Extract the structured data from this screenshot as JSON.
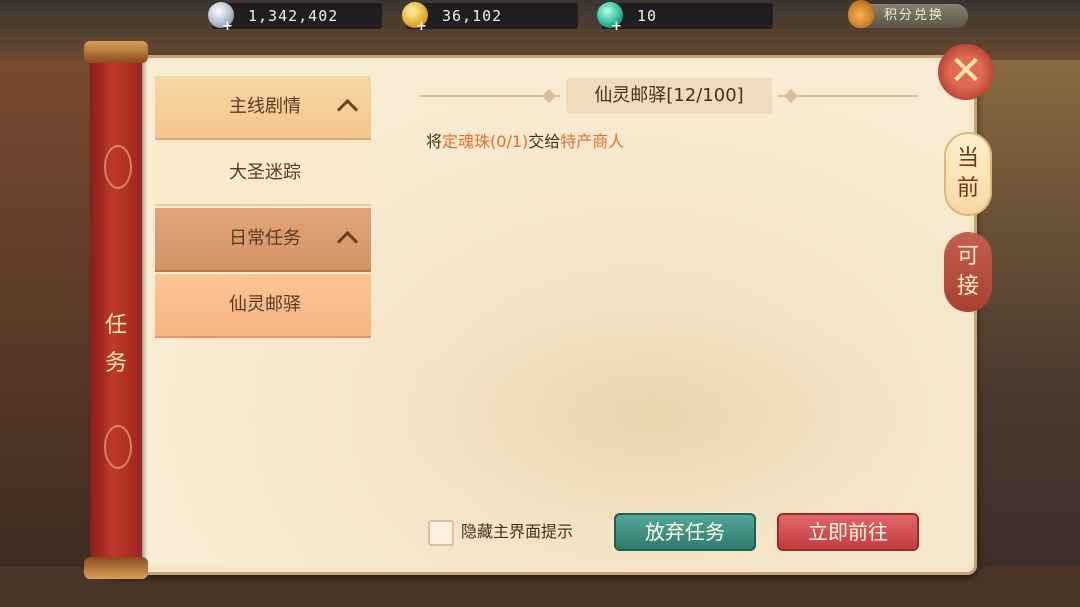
{
  "currencies": [
    {
      "name": "silver",
      "icon": "silver-coin-icon",
      "value": "1,342,402"
    },
    {
      "name": "gold",
      "icon": "gold-coin-icon",
      "value": "36,102"
    },
    {
      "name": "jade",
      "icon": "jade-icon",
      "value": "10"
    }
  ],
  "points_exchange": {
    "label": "积分兑换",
    "icon": "money-bag-icon"
  },
  "spine": {
    "label_line1": "任",
    "label_line2": "务"
  },
  "categories": {
    "main": {
      "label": "主线剧情"
    },
    "main_quest": {
      "label": "大圣迷踪"
    },
    "daily": {
      "label": "日常任务"
    },
    "daily_quest": {
      "label": "仙灵邮驿"
    }
  },
  "quest": {
    "title": "仙灵邮驿[12/100]",
    "desc_prefix": "将",
    "desc_item": "定魂珠(0/1)",
    "desc_mid": "交给",
    "desc_npc": "特产商人"
  },
  "tabs": {
    "current": {
      "line1": "当",
      "line2": "前"
    },
    "available": {
      "line1": "可",
      "line2": "接"
    }
  },
  "close": {
    "glyph": "✕"
  },
  "footer": {
    "hide_hint_label": "隐藏主界面提示",
    "abandon_label": "放弃任务",
    "go_label": "立即前往"
  },
  "colors": {
    "highlight": "#e0702a",
    "abandon": "#2d7a6c",
    "go": "#c23a3e"
  }
}
